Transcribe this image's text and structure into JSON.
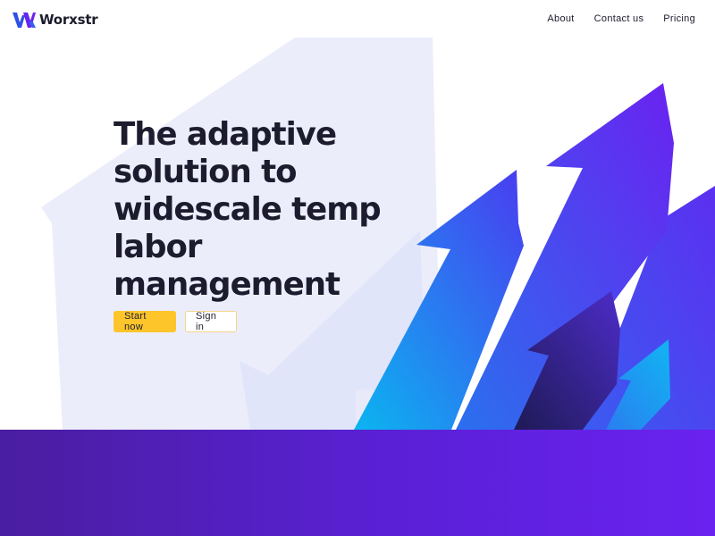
{
  "brand": {
    "name": "Worxstr",
    "colors": {
      "primary": "#5a20d6",
      "accent": "#fec52b",
      "dark": "#1c1c2e"
    },
    "logo_icon": "wx-logo-icon"
  },
  "nav": {
    "items": [
      {
        "label": "About"
      },
      {
        "label": "Contact us"
      },
      {
        "label": "Pricing"
      }
    ]
  },
  "hero": {
    "headline": "The adaptive solution to widescale temp labor management",
    "primary_cta": "Start now",
    "secondary_cta": "Sign in",
    "illustration": "rising-arrows-illustration"
  }
}
